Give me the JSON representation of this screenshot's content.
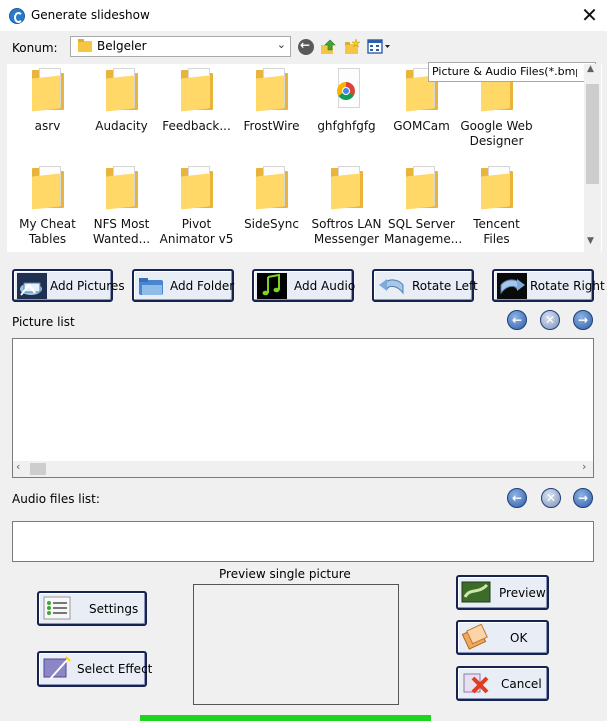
{
  "window": {
    "title": "Generate slideshow",
    "close": "✕"
  },
  "toolbar": {
    "location_label": "Konum:",
    "location_value": "Belgeler",
    "filter_value": "Picture & Audio Files(*.bmp;*.jp"
  },
  "files": [
    {
      "name": "asrv",
      "type": "folder"
    },
    {
      "name": "Audacity",
      "type": "folder"
    },
    {
      "name": "Feedback...",
      "type": "folder"
    },
    {
      "name": "FrostWire",
      "type": "folder"
    },
    {
      "name": "ghfghfgfg",
      "type": "chrome"
    },
    {
      "name": "GOMCam",
      "type": "folder"
    },
    {
      "name": "Google Web Designer",
      "type": "folder"
    },
    {
      "name": "My Cheat Tables",
      "type": "folder"
    },
    {
      "name": "NFS Most Wanted...",
      "type": "folder"
    },
    {
      "name": "Pivot Animator v5",
      "type": "folder"
    },
    {
      "name": "SideSync",
      "type": "folder"
    },
    {
      "name": "Softros LAN Messenger",
      "type": "folder"
    },
    {
      "name": "SQL Server Manageme...",
      "type": "folder"
    },
    {
      "name": "Tencent Files",
      "type": "folder"
    }
  ],
  "buttons": {
    "add_pictures": "Add Pictures",
    "add_folder": "Add Folder",
    "add_audio": "Add Audio",
    "rotate_left": "Rotate Left",
    "rotate_right": "Rotate Right",
    "settings": "Settings",
    "select_effect": "Select Effect",
    "preview": "Preview",
    "ok": "OK",
    "cancel": "Cancel"
  },
  "sections": {
    "picture_list": "Picture list",
    "audio_list": "Audio files list:",
    "preview_single": "Preview single picture"
  },
  "colors": {
    "button_border": "#16234f",
    "progress": "#1ed41e",
    "folder": "#ffd867"
  }
}
